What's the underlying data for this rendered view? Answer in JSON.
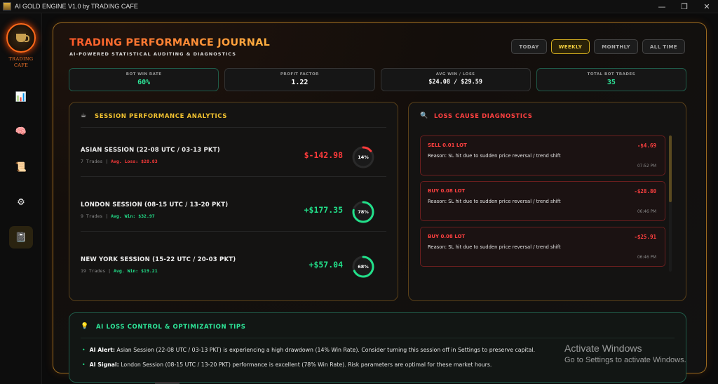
{
  "window": {
    "title": "AI GOLD ENGINE V1.0 by TRADING CAFE",
    "minimize": "—",
    "maximize": "❐",
    "close": "✕"
  },
  "sidebar": {
    "logo_text_1": "TRADING",
    "logo_text_2": "CAFE",
    "items": [
      {
        "icon": "chart-icon",
        "glyph": "📊"
      },
      {
        "icon": "brain-icon",
        "glyph": "🧠"
      },
      {
        "icon": "scroll-icon",
        "glyph": "📜"
      },
      {
        "icon": "gear-icon",
        "glyph": "⚙"
      },
      {
        "icon": "journal-icon",
        "glyph": "📓",
        "active": true
      }
    ]
  },
  "header": {
    "title": "TRADING PERFORMANCE JOURNAL",
    "subtitle": "AI-POWERED STATISTICAL AUDITING & DIAGNOSTICS",
    "filters": [
      "TODAY",
      "WEEKLY",
      "MONTHLY",
      "ALL TIME"
    ],
    "active_filter": "WEEKLY"
  },
  "stats": [
    {
      "label": "BOT WIN RATE",
      "value": "60%",
      "color": "#2ee89a"
    },
    {
      "label": "PROFIT FACTOR",
      "value": "1.22",
      "color": "#ffffff"
    },
    {
      "label": "AVG WIN / LOSS",
      "value": "$24.08 / $29.59",
      "color": "#ffffff"
    },
    {
      "label": "TOTAL BOT TRADES",
      "value": "35",
      "color": "#2ee89a"
    }
  ],
  "sessions": {
    "title": "SESSION PERFORMANCE ANALYTICS",
    "icon": "sun-icon",
    "items": [
      {
        "name": "ASIAN SESSION (22-08 UTC / 03-13 PKT)",
        "trades": "7 Trades",
        "sep": "|",
        "avg": "Avg. Loss: $28.83",
        "pnl": "$-142.98",
        "win_rate_text": "14%",
        "win_rate": 0.14,
        "color": "#ff3b3b"
      },
      {
        "name": "LONDON SESSION (08-15 UTC / 13-20 PKT)",
        "trades": "9 Trades",
        "sep": "|",
        "avg": "Avg. Win: $32.97",
        "pnl": "+$177.35",
        "win_rate_text": "78%",
        "win_rate": 0.78,
        "color": "#22e08a"
      },
      {
        "name": "NEW YORK SESSION (15-22 UTC / 20-03 PKT)",
        "trades": "19 Trades",
        "sep": "|",
        "avg": "Avg. Win: $19.21",
        "pnl": "+$57.04",
        "win_rate_text": "68%",
        "win_rate": 0.68,
        "color": "#22e08a"
      }
    ]
  },
  "losses": {
    "title": "LOSS CAUSE DIAGNOSTICS",
    "icon": "magnifier-icon",
    "items": [
      {
        "type": "SELL 0.01 LOT",
        "amount": "-$4.69",
        "reason": "Reason: SL hit due to sudden price reversal / trend shift",
        "time": "07:52 PM"
      },
      {
        "type": "BUY 0.08 LOT",
        "amount": "-$28.80",
        "reason": "Reason: SL hit due to sudden price reversal / trend shift",
        "time": "06:46 PM"
      },
      {
        "type": "BUY 0.08 LOT",
        "amount": "-$25.91",
        "reason": "Reason: SL hit due to sudden price reversal / trend shift",
        "time": "06:46 PM"
      }
    ]
  },
  "tips": {
    "title": "AI LOSS CONTROL & OPTIMIZATION TIPS",
    "icon": "lightbulb-icon",
    "items": [
      {
        "label": "AI Alert:",
        "text": " Asian Session (22-08 UTC / 03-13 PKT) is experiencing a high drawdown (14% Win Rate). Consider turning this session off in Settings to preserve capital."
      },
      {
        "label": "AI Signal:",
        "text": " London Session (08-15 UTC / 13-20 PKT) performance is excellent (78% Win Rate). Risk parameters are optimal for these market hours."
      }
    ]
  },
  "watermark": {
    "line1": "Activate Windows",
    "line2": "Go to Settings to activate Windows."
  }
}
